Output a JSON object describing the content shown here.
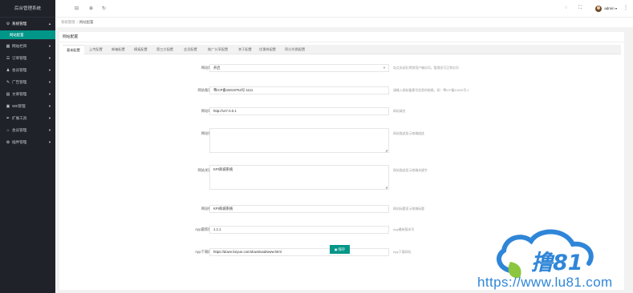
{
  "sidebar": {
    "logo": "后台管理系统",
    "items": [
      {
        "label": "系统管理",
        "icon": "gear-icon",
        "glyph": "⚙",
        "open": true
      },
      {
        "label": "网站栏目",
        "icon": "columns-icon",
        "glyph": "▦"
      },
      {
        "label": "订单管理",
        "icon": "order-icon",
        "glyph": "☰"
      },
      {
        "label": "会员管理",
        "icon": "user-icon",
        "glyph": "♟"
      },
      {
        "label": "广告管理",
        "icon": "pin-icon",
        "glyph": "✎"
      },
      {
        "label": "文章管理",
        "icon": "file-icon",
        "glyph": "▤"
      },
      {
        "label": "WE管理",
        "icon": "chat-icon",
        "glyph": "▣"
      },
      {
        "label": "扩展工具",
        "icon": "tool-icon",
        "glyph": "✒"
      },
      {
        "label": "会员管理",
        "icon": "bag-icon",
        "glyph": "⌂"
      },
      {
        "label": "插件管理",
        "icon": "plugin-icon",
        "glyph": "✿"
      }
    ],
    "submenu": [
      "网站配置"
    ]
  },
  "header": {
    "user_name": "admin",
    "icons": [
      "menu-fold-icon",
      "globe-icon",
      "refresh-icon",
      "message-icon",
      "fullscreen-icon",
      "more-icon"
    ]
  },
  "breadcrumb": {
    "items": [
      "系统管理",
      "网站配置"
    ]
  },
  "card": {
    "title": "网站配置",
    "tabs": [
      "基本配置",
      "上传配置",
      "邮箱配置",
      "模板配置",
      "第三方配置",
      "会员配置",
      "推广分享配置",
      "关于配置",
      "优惠券配置",
      "积分兑换配置"
    ],
    "active_tab": 0
  },
  "form": {
    "status": {
      "label": "网站状态",
      "value": "开启",
      "hint": "站点关闭后将禁用户端访问，管理员可正常访问"
    },
    "icp": {
      "label": "网站备案号",
      "value": "粤ICP备15019753号-1111",
      "hint": "请输入网站备案号信息的前缀，如：粤ICP备10020号-1"
    },
    "domain": {
      "label": "网站域名",
      "value": "http://127.0.0.1",
      "hint": "网站域名"
    },
    "description": {
      "label": "网站描述",
      "value": "",
      "hint": "网站描述显示前端描述"
    },
    "keywords": {
      "label": "网站关键字",
      "value": "KPI商城系统",
      "hint": "网站描述显示前端关键字"
    },
    "title": {
      "label": "网站标题",
      "value": "KPI商城系统",
      "hint": "网站标题显示前端标题"
    },
    "app_version": {
      "label": "App最新版本",
      "value": "1.1.1",
      "hint": "App最新版本号"
    },
    "download_url": {
      "label": "App下载网址",
      "value": "https://down.lixiyun.com/download/www.html",
      "hint": "App下载网址"
    }
  },
  "save_label": "保存",
  "watermark": {
    "brand": "撸81",
    "url": "https://www.lu81.com"
  },
  "colors": {
    "accent": "#009688",
    "sidebar": "#20222a",
    "watermark": "#2f86d8"
  }
}
